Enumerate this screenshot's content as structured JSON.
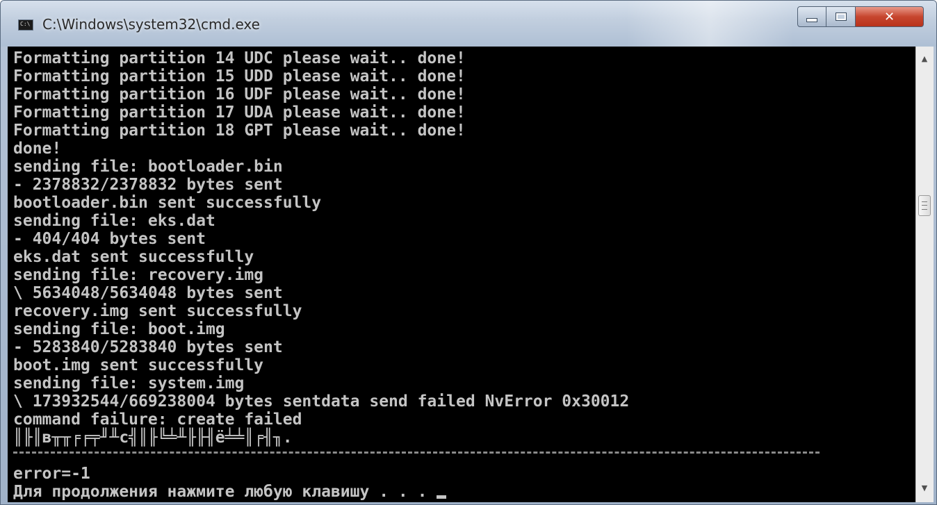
{
  "window": {
    "title": "C:\\Windows\\system32\\cmd.exe",
    "icon_text": "C:\\",
    "controls": {
      "close_label": "✕"
    }
  },
  "console": {
    "lines": [
      "Formatting partition 14 UDC please wait.. done!",
      "Formatting partition 15 UDD please wait.. done!",
      "Formatting partition 16 UDF please wait.. done!",
      "Formatting partition 17 UDA please wait.. done!",
      "Formatting partition 18 GPT please wait.. done!",
      "done!",
      "sending file: bootloader.bin",
      "- 2378832/2378832 bytes sent",
      "bootloader.bin sent successfully",
      "sending file: eks.dat",
      "- 404/404 bytes sent",
      "eks.dat sent successfully",
      "sending file: recovery.img",
      "\\ 5634048/5634048 bytes sent",
      "recovery.img sent successfully",
      "sending file: boot.img",
      "- 5283840/5283840 bytes sent",
      "boot.img sent successfully",
      "sending file: system.img",
      "\\ 173932544/669238004 bytes sentdata send failed NvError 0x30012",
      "command failure: create failed",
      "║╟║в╥╥╒╒╤╜╨с╣║╟╚╧╨╟╟╢ё╧╧║╒╢╖."
    ],
    "error_line": "error=-1",
    "prompt_line": "Для продолжения нажмите любую клавишу . . . "
  },
  "colors": {
    "console_bg": "#000000",
    "console_fg": "#c4c4c4",
    "close_button": "#c7462f"
  },
  "icons": [
    "cmd-app-icon",
    "minimize-icon",
    "maximize-icon",
    "close-icon",
    "scroll-up-icon",
    "scroll-down-icon",
    "scroll-grip-icon"
  ]
}
